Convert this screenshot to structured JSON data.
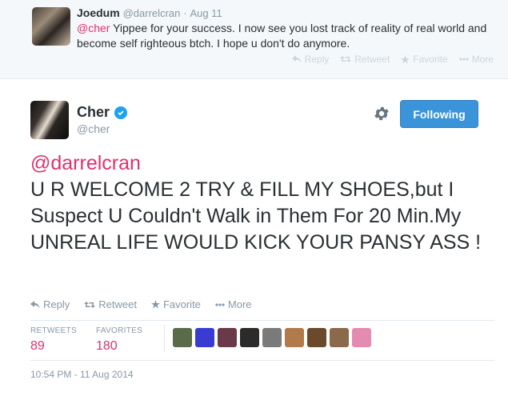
{
  "reply": {
    "name": "Joedum",
    "handle": "@darrelcran",
    "dot": "·",
    "date": "Aug 11",
    "mention": "@cher",
    "text": " Yippee for your success. I now see you lost track of reality of real world and become self righteous btch. I hope u don't do anymore.",
    "actions": {
      "reply": "Reply",
      "retweet": "Retweet",
      "favorite": "Favorite",
      "more": "More"
    }
  },
  "tweet": {
    "name": "Cher",
    "handle": "@cher",
    "follow_label": "Following",
    "mention": "@darrelcran",
    "text": "U R WELCOME 2 TRY & FILL MY SHOES,but I Suspect U Couldn't Walk in Them For 20 Min.My UNREAL LIFE WOULD KICK YOUR PANSY ASS !",
    "actions": {
      "reply": "Reply",
      "retweet": "Retweet",
      "favorite": "Favorite",
      "more": "More"
    },
    "stats": {
      "retweets_label": "RETWEETS",
      "retweets_value": "89",
      "favorites_label": "FAVORITES",
      "favorites_value": "180"
    },
    "timestamp": "10:54 PM - 11 Aug 2014"
  },
  "favoriters": [
    {
      "color": "#5a6b4a"
    },
    {
      "color": "#3a3bd0"
    },
    {
      "color": "#6b3a4a"
    },
    {
      "color": "#2b2b2b"
    },
    {
      "color": "#7a7a7a"
    },
    {
      "color": "#b07a4a"
    },
    {
      "color": "#6a4a2a"
    },
    {
      "color": "#8a6a4a"
    },
    {
      "color": "#e58ab0"
    }
  ],
  "colors": {
    "accent": "#3b94d9",
    "mention": "#e1306c",
    "verified": "#1da1f2"
  },
  "icons": {
    "verified": "verified-badge-icon",
    "gear": "gear-icon"
  }
}
